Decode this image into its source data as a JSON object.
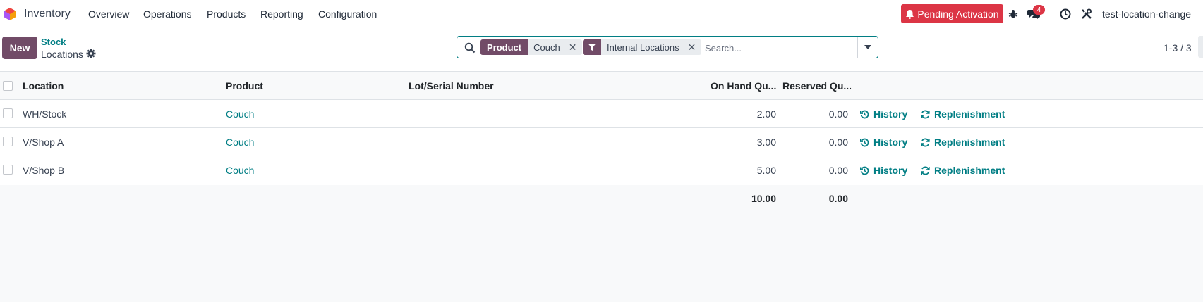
{
  "navbar": {
    "app_name": "Inventory",
    "menu": [
      "Overview",
      "Operations",
      "Products",
      "Reporting",
      "Configuration"
    ],
    "pending_activation": "Pending Activation",
    "messages_count": "4",
    "user": "test-location-change"
  },
  "control_panel": {
    "new_button": "New",
    "breadcrumb_parent": "Stock",
    "breadcrumb_current": "Locations",
    "search": {
      "facet_product_label": "Product",
      "facet_product_value": "Couch",
      "facet_filter_value": "Internal Locations",
      "placeholder": "Search..."
    },
    "pager": "1-3 / 3"
  },
  "list": {
    "columns": {
      "location": "Location",
      "product": "Product",
      "lot": "Lot/Serial Number",
      "on_hand": "On Hand Qu...",
      "reserved": "Reserved Qu..."
    },
    "rows": [
      {
        "location": "WH/Stock",
        "product": "Couch",
        "on_hand": "2.00",
        "reserved": "0.00",
        "history": "History",
        "replenishment": "Replenishment"
      },
      {
        "location": "V/Shop A",
        "product": "Couch",
        "on_hand": "3.00",
        "reserved": "0.00",
        "history": "History",
        "replenishment": "Replenishment"
      },
      {
        "location": "V/Shop B",
        "product": "Couch",
        "on_hand": "5.00",
        "reserved": "0.00",
        "history": "History",
        "replenishment": "Replenishment"
      }
    ],
    "totals": {
      "on_hand": "10.00",
      "reserved": "0.00"
    }
  },
  "colors": {
    "brand": "#714b67",
    "link": "#017e84",
    "danger": "#dc3545"
  },
  "icons": [
    "odoo-logo-icon",
    "search-icon",
    "filter-icon",
    "close-icon",
    "caret-down-icon",
    "bell-icon",
    "bug-icon",
    "chat-icon",
    "clock-icon",
    "tools-icon",
    "gear-icon",
    "history-icon",
    "refresh-icon"
  ]
}
